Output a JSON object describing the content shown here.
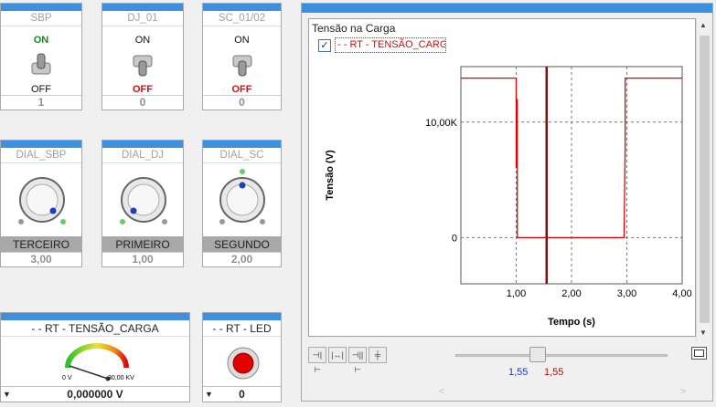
{
  "toggles": [
    {
      "name": "SBP",
      "on": "ON",
      "off": "OFF",
      "value": "1"
    },
    {
      "name": "DJ_01",
      "on": "ON",
      "off": "OFF",
      "value": "0"
    },
    {
      "name": "SC_01/02",
      "on": "ON",
      "off": "OFF",
      "value": "0"
    }
  ],
  "dials": [
    {
      "name": "DIAL_SBP",
      "label": "TERCEIRO",
      "value": "3,00"
    },
    {
      "name": "DIAL_DJ",
      "label": "PRIMEIRO",
      "value": "1,00"
    },
    {
      "name": "DIAL_SC",
      "label": "SEGUNDO",
      "value": "2,00"
    }
  ],
  "meter": {
    "title": "- - RT - TENSÃO_CARGA",
    "min_label": "0 V",
    "max_label": "30,00 KV",
    "value": "0,000000 V",
    "needle_fraction": 0.0
  },
  "led": {
    "title": "- - RT - LED",
    "value": "0",
    "color": "#e00000"
  },
  "chart_panel": {
    "title": "Tensão na Carga",
    "legend": "- - RT - TENSÃO_CARG",
    "legend_checked": true,
    "cursor_left": "1,55",
    "cursor_right": "1,55"
  },
  "chart_data": {
    "type": "line",
    "xlabel": "Tempo (s)",
    "ylabel": "Tensão (V)",
    "xlim": [
      0,
      4
    ],
    "ylim": [
      -4000,
      14800
    ],
    "x_ticks": [
      "1,00",
      "2,00",
      "3,00",
      "4,00"
    ],
    "y_ticks": [
      {
        "value": 0,
        "label": "0"
      },
      {
        "value": 10000,
        "label": "10,00K"
      }
    ],
    "grid": true,
    "cursor_x": 1.55,
    "series": [
      {
        "color": "#e00000",
        "x": [
          0,
          1.0,
          1.0,
          1.02,
          1.02,
          1.04,
          1.04,
          2.95,
          2.95,
          2.97,
          2.97,
          4.0
        ],
        "y": [
          13800,
          13800,
          6000,
          12000,
          0,
          0,
          0,
          0,
          0,
          8000,
          13800,
          13800
        ]
      }
    ]
  },
  "colors": {
    "header_bar": "#3d8fe0",
    "on_green": "#1f8a1f",
    "off_red": "#d01010"
  }
}
